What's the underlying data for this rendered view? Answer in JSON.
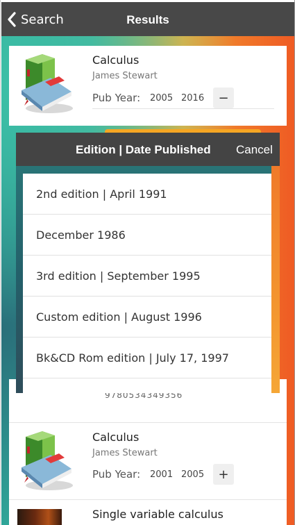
{
  "navbar": {
    "back_label": "Search",
    "title": "Results"
  },
  "results": [
    {
      "title": "Calculus",
      "author": "James Stewart",
      "pub_label": "Pub Year:",
      "year_start": "2005",
      "year_end": "2016",
      "toggle": "−"
    },
    {
      "title": "Calculus",
      "author": "James Stewart",
      "pub_label": "Pub Year:",
      "year_start": "2001",
      "year_end": "2005",
      "toggle": "+"
    },
    {
      "title": "Single variable calculus"
    }
  ],
  "isbn_fragment": "9780534349356",
  "picker": {
    "title": "Edition | Date Published",
    "cancel": "Cancel",
    "items": [
      "2nd edition | April 1991",
      "December 1986",
      "3rd edition | September 1995",
      "Custom edition | August 1996",
      "Bk&CD Rom edition | July 17, 1997"
    ]
  }
}
